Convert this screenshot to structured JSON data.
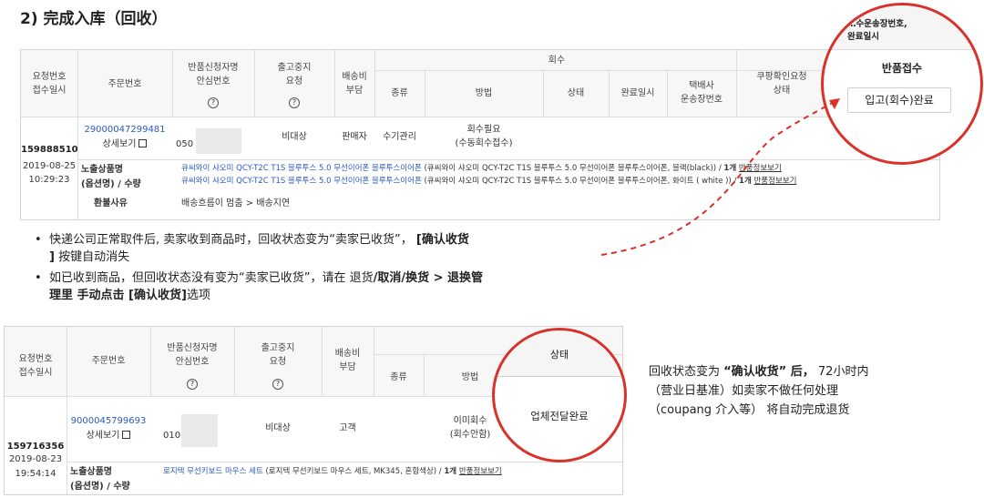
{
  "title": "2) 完成入库（回收）",
  "table1": {
    "headers": {
      "req": "요청번호\n접수일시",
      "order": "주문번호",
      "applicant": "반품신청자명\n안심번호",
      "stop": "출고중지\n요청",
      "ship": "배송비\n부담",
      "recovery": "회수",
      "type": "종류",
      "method": "방법",
      "status": "상태",
      "done": "완료일시",
      "carrier": "택배사\n운송장번호",
      "coupang": "쿠팡확인요청\n상태"
    },
    "row": {
      "req_no": "159888510",
      "req_date": "2019-08-25",
      "req_time": "10:29:23",
      "order_no": "29000047299481",
      "detail": "상세보기",
      "phone": "050",
      "stop": "비대상",
      "ship": "판매자",
      "type": "수기관리",
      "method": "회수필요\n(수동회수접수)"
    },
    "product_label": "노출상품명\n(옵션명) / 수량",
    "products": [
      {
        "name": "큐씨와이 샤오미 QCY-T2C T1S 블루투스 5.0 무선이어폰 블루투스이어폰",
        "option": " (큐씨와이 샤오미 QCY-T2C T1S 블루투스 5.0 무선이어폰 블루투스이어폰, 블랙(black)) / ",
        "qty": "1개",
        "info": "반품정보보기"
      },
      {
        "name": "큐씨와이 샤오미 QCY-T2C T1S 블루투스 5.0 무선이어폰 블루투스이어폰",
        "option": " (큐씨와이 샤오미 QCY-T2C T1S 블루투스 5.0 무선이어폰 블루투스이어폰, 화이트 ( white )) / ",
        "qty": "1개",
        "info": "반품정보보기"
      }
    ],
    "reason_label": "환불사유",
    "reason": "배송흐름이 멈춤 > 배송지연"
  },
  "zoom1": {
    "header": "…수운송장번호,\n완료일시",
    "label": "반품접수",
    "button": "입고(회수)완료"
  },
  "bullets": [
    {
      "a": "快递公司正常取件后, 卖家收到商品时，回收状态变为“卖家已收货”， ",
      "b": "[确认收货",
      "c": "] 按键自动消失",
      "c_bold": "]"
    },
    {
      "a": "如已收到商品，但回收状态没有变为“卖家已收货”，请在 退货",
      "b": "/取消/换货 > 退换管",
      "c": "理里 手动点击 [确认收货]",
      "d": "选项"
    }
  ],
  "bullet1_line1": "快递公司正常取件后, 卖家收到商品时，回收状态变为“卖家已收货”，",
  "bullet1_bold": "[确认收货",
  "bullet1_line2_bold": "]",
  "bullet1_line2": " 按键自动消失",
  "bullet2_line1": "如已收到商品，但回收状态没有变为“卖家已收货”，请在 退货",
  "bullet2_bold1": "/取消/换货 > 退换管",
  "bullet2_bold2": "理里 手动点击 [确认收货]",
  "bullet2_end": "选项",
  "table2": {
    "headers": {
      "req": "요청번호\n접수일시",
      "order": "주문번호",
      "applicant": "반품신청자명\n안심번호",
      "stop": "출고중지\n요청",
      "ship": "배송비\n부담",
      "type": "종류",
      "method": "방법",
      "status": "상태"
    },
    "row": {
      "req_no": "159716356",
      "req_date": "2019-08-23",
      "req_time": "19:54:14",
      "order_no": "9000045799693",
      "detail": "상세보기",
      "phone": "010",
      "stop": "비대상",
      "ship": "고객",
      "method": "이미회수\n(회수안함)",
      "status": "업체전달완료"
    },
    "product_label": "노출상품명\n(옵션명) / 수량",
    "product": {
      "name": "로지텍 무선키보드 마우스 세트",
      "option": " (로지텍 무선키보드 마우스 세트, MK345, 혼합색상) / ",
      "qty": "1개",
      "info": "반품정보보기"
    }
  },
  "note": {
    "l1a": "回收状态变为 ",
    "l1b": "“确认收货” 后，",
    "l1c": " 72小时内",
    "l2": "（营业日基准）如卖家不做任何处理",
    "l3": "（coupang 介入等） 将自动完成退货"
  },
  "colors": {
    "accent_red": "#d8322b",
    "link_blue": "#2b59c3"
  }
}
